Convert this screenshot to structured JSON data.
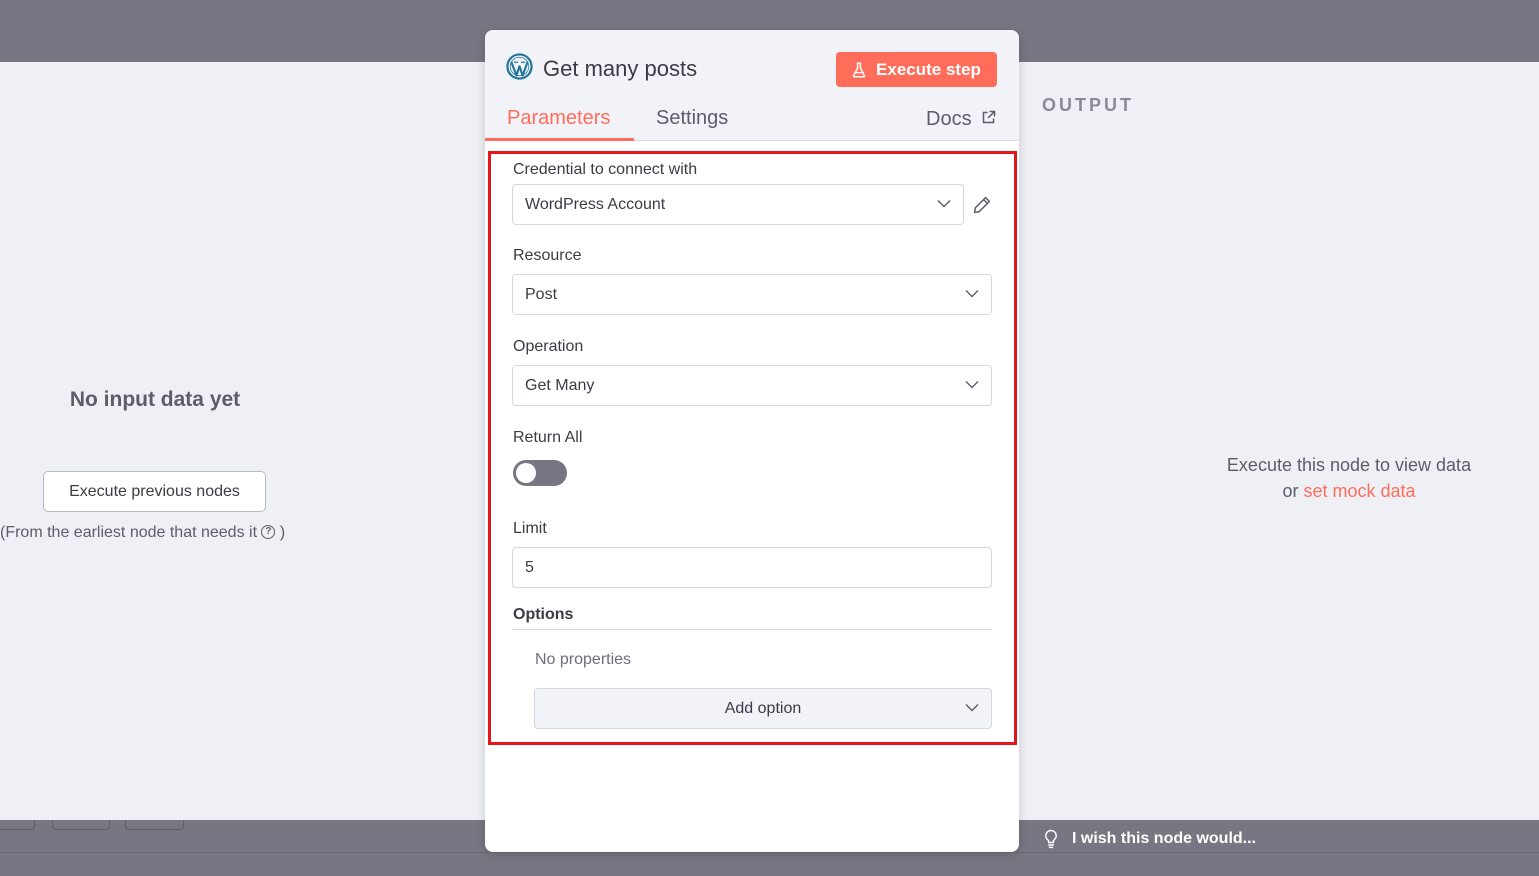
{
  "input_pane": {
    "empty_title": "No input data yet",
    "execute_button_label": "Execute previous nodes",
    "hint_text": "(From the earliest node that needs it",
    "hint_close": " )",
    "help_icon": "question-circle-icon"
  },
  "output_pane": {
    "label": "OUTPUT",
    "hint_line1": "Execute this node to view data",
    "hint_or": "or ",
    "mock_link": "set mock data"
  },
  "panel": {
    "title": "Get many posts",
    "app_icon": "wordpress-logo-icon",
    "execute_step_label": "Execute step",
    "tabs": [
      {
        "label": "Parameters",
        "active": true
      },
      {
        "label": "Settings",
        "active": false
      }
    ],
    "docs_label": "Docs"
  },
  "form": {
    "credential": {
      "label": "Credential to connect with",
      "value": "WordPress Account"
    },
    "resource": {
      "label": "Resource",
      "value": "Post"
    },
    "operation": {
      "label": "Operation",
      "value": "Get Many"
    },
    "return_all": {
      "label": "Return All",
      "enabled": false
    },
    "limit": {
      "label": "Limit",
      "value": "5"
    },
    "options": {
      "label": "Options",
      "empty_text": "No properties",
      "add_label": "Add option"
    }
  },
  "footer": {
    "wish_text": "I wish this node would..."
  },
  "colors": {
    "accent": "#ff6d5a",
    "highlight_border": "#e8141c",
    "backdrop": "#777682",
    "pane_background": "#eef0f5"
  }
}
